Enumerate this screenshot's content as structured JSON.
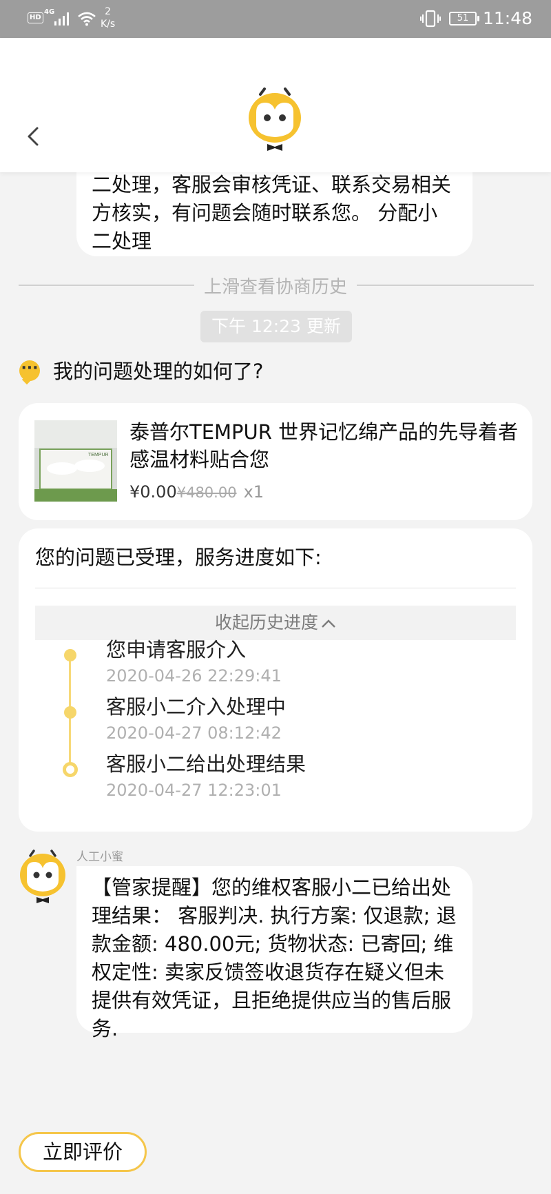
{
  "status_bar": {
    "hd": "HD",
    "network": "4G",
    "speed_value": "2",
    "speed_unit": "K/s",
    "battery": "51",
    "time": "11:48"
  },
  "header": {
    "back_icon": "chevron-left-icon",
    "logo_icon": "owl-mascot-icon"
  },
  "chat": {
    "previous_message": "二处理，客服会审核凭证、联系交易相关方核实，有问题会随时联系您。 分配小二处理",
    "history_hint": "上滑查看协商历史",
    "update_time": "下午 12:23 更新",
    "question": "我的问题处理的如何了?",
    "question_icon": "chat-dots-icon"
  },
  "product": {
    "title": "泰普尔TEMPUR 世界记忆绵产品的先导着者 感温材料贴合您",
    "price": "¥0.00",
    "original_price": "¥480.00",
    "quantity": "x1",
    "thumb_brand": "TEMPUR"
  },
  "progress": {
    "title": "您的问题已受理，服务进度如下:",
    "collapse_label": "收起历史进度",
    "steps": [
      {
        "label": "您申请客服介入",
        "time": "2020-04-26 22:29:41"
      },
      {
        "label": "客服小二介入处理中",
        "time": "2020-04-27 08:12:42"
      },
      {
        "label": "客服小二给出处理结果",
        "time": "2020-04-27 12:23:01"
      }
    ]
  },
  "agent": {
    "name": "人工小蜜",
    "message": "【管家提醒】您的维权客服小二已给出处理结果： 客服判决. 执行方案: 仅退款; 退款金额: 480.00元; 货物状态: 已寄回; 维权定性: 卖家反馈签收退货存在疑义但未提供有效凭证，且拒绝提供应当的售后服务."
  },
  "actions": {
    "rate_label": "立即评价"
  },
  "colors": {
    "accent": "#F6C22F",
    "timeline": "#F6D66A",
    "status_bar": "#9D9D9D",
    "background": "#F3F3F3"
  }
}
